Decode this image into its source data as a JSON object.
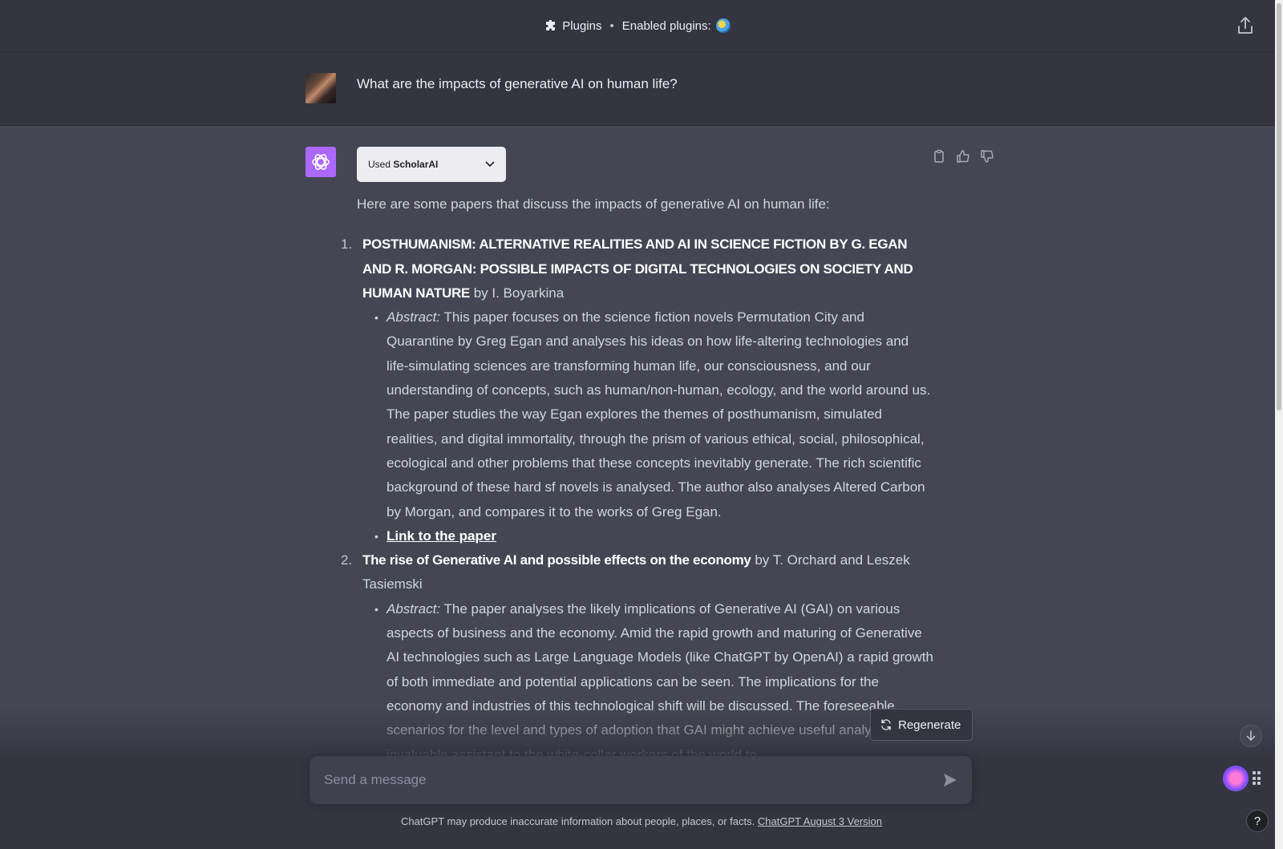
{
  "header": {
    "plugins_label": "Plugins",
    "enabled_label": "Enabled plugins:"
  },
  "user_message": {
    "text": "What are the impacts of generative AI on human life?"
  },
  "assistant": {
    "used_prefix": "Used",
    "used_plugin": "ScholarAI",
    "intro": "Here are some papers that discuss the impacts of generative AI on human life:",
    "papers": [
      {
        "num": "1.",
        "title": "POSTHUMANISM: ALTERNATIVE REALITIES AND AI IN SCIENCE FICTION BY G. EGAN AND R. MORGAN: POSSIBLE IMPACTS OF DIGITAL TECHNOLOGIES ON SOCIETY AND HUMAN NATURE",
        "authors": "by I. Boyarkina",
        "abstract_label": "Abstract:",
        "abstract": "This paper focuses on the science fiction novels Permutation City and Quarantine by Greg Egan and analyses his ideas on how life-altering technologies and life-simulating sciences are transforming human life, our consciousness, and our understanding of concepts, such as human/non-human, ecology, and the world around us. The paper studies the way Egan explores the themes of posthumanism, simulated realities, and digital immortality, through the prism of various ethical, social, philosophical, ecological and other problems that these concepts inevitably generate. The rich scientific background of these hard sf novels is analysed. The author also analyses Altered Carbon by Morgan, and compares it to the works of Greg Egan.",
        "link": "Link to the paper"
      },
      {
        "num": "2.",
        "title": "The rise of Generative AI and possible effects on the economy",
        "authors": "by T. Orchard and Leszek Tasiemski",
        "abstract_label": "Abstract:",
        "abstract": "The paper analyses the likely implications of Generative AI (GAI) on various aspects of business and the economy. Amid the rapid growth and maturing of Generative AI technologies such as Large Language Models (like ChatGPT by OpenAI) a rapid growth of both immediate and potential applications can be seen. The implications for the economy and industries of this technological shift will be discussed. The foreseeable scenarios for the level and types of adoption that GAI might achieve useful analytical tool, invaluable assistant to the white-collar workers of the world to"
      }
    ]
  },
  "regenerate_label": "Regenerate",
  "input": {
    "placeholder": "Send a message"
  },
  "footer": {
    "text": "ChatGPT may produce inaccurate information about people, places, or facts.",
    "link": "ChatGPT August 3 Version"
  },
  "help_label": "?"
}
